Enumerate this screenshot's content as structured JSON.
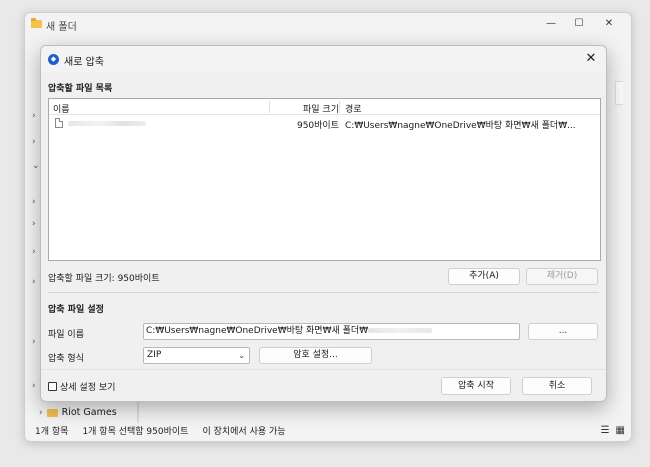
{
  "explorer": {
    "title": "새 폴더",
    "window_controls": {
      "minimize": "—",
      "maximize": "☐",
      "close": "✕"
    },
    "sidebar": {
      "expand_arrows": [
        "›",
        "›",
        "⌄",
        "›",
        "›",
        "›",
        "›",
        "›",
        "›"
      ],
      "visible_item": "Riot Games"
    },
    "status": {
      "item_count": "1개 항목",
      "selected": "1개 항목 선택함 950바이트",
      "availability": "이 장치에서 사용 가능"
    }
  },
  "dialog": {
    "title": "새로 압축",
    "close_glyph": "✕",
    "file_list": {
      "section_title": "압축할 파일 목록",
      "columns": {
        "name": "이름",
        "size": "파일 크기",
        "path": "경로"
      },
      "rows": [
        {
          "name": "",
          "size": "950바이트",
          "path": "C:₩Users₩nagne₩OneDrive₩바탕 화면₩새 폴더₩..."
        }
      ],
      "total_size_label": "압축할 파일 크기: 950바이트",
      "add_button": "추가(A)",
      "remove_button": "제거(D)"
    },
    "settings": {
      "section_title": "압축 파일 설정",
      "filename_label": "파일 이름",
      "filename_value": "C:₩Users₩nagne₩OneDrive₩바탕 화면₩새 폴더₩",
      "browse_button": "...",
      "format_label": "압축 형식",
      "format_value": "ZIP",
      "password_button": "암호 설정..."
    },
    "footer": {
      "advanced_checkbox_label": "상세 설정 보기",
      "start_button": "압축 시작",
      "cancel_button": "취소"
    }
  }
}
